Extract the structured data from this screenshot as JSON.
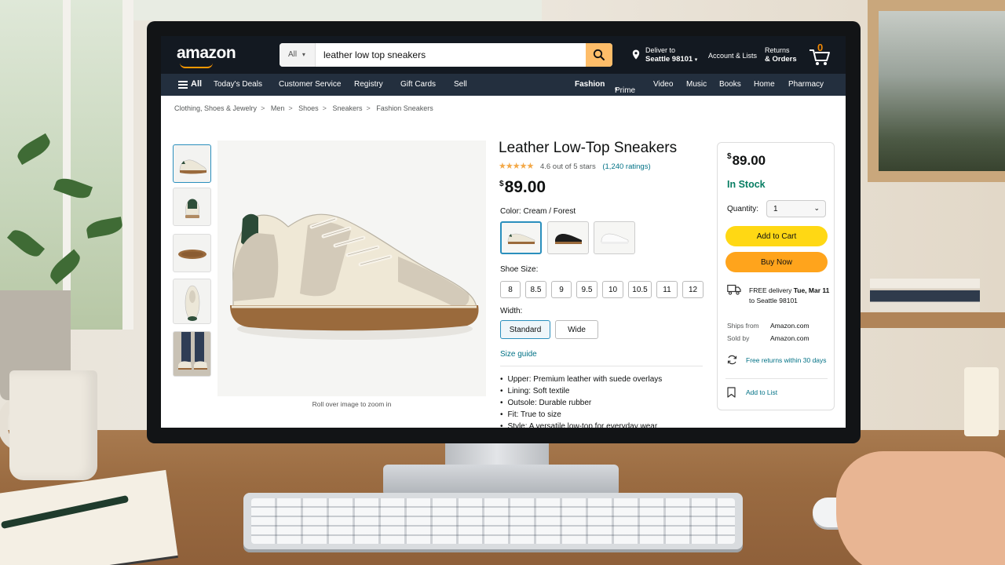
{
  "header": {
    "logo": "amazon",
    "search_category": "All",
    "search_query": "leather low top sneakers",
    "deliver_line1": "Deliver to",
    "deliver_line2": "Seattle 98101",
    "account": "Account & Lists",
    "returns_line1": "Returns",
    "returns_line2": "& Orders",
    "cart_count": "0"
  },
  "nav": {
    "all": "All",
    "left": [
      "Today's Deals",
      "Customer Service",
      "Registry",
      "Gift Cards",
      "Sell"
    ],
    "right": [
      "Fashion",
      "Prime",
      "Video",
      "Music",
      "Books",
      "Home",
      "Pharmacy"
    ]
  },
  "breadcrumb": [
    "Clothing, Shoes & Jewelry",
    "Men",
    "Shoes",
    "Sneakers",
    "Fashion Sneakers"
  ],
  "gallery": {
    "thumbnail_count": 5,
    "zoom_hint": "Roll over image to zoom in"
  },
  "product": {
    "title": "Leather Low-Top Sneakers",
    "rating_text": "4.6 out of 5 stars",
    "rating_value": 4.6,
    "ratings_link": "(1,240 ratings)",
    "price_symbol": "$",
    "price": "89.00",
    "color_label": "Color:",
    "color_value": "Cream / Forest",
    "color_options": [
      "Cream / Forest",
      "Black",
      "White"
    ],
    "size_label": "Shoe Size:",
    "sizes": [
      "8",
      "8.5",
      "9",
      "9.5",
      "10",
      "10.5",
      "11",
      "12"
    ],
    "width_label": "Width:",
    "widths": [
      "Standard",
      "Wide"
    ],
    "size_guide": "Size guide",
    "bullets": [
      "Upper: Premium leather with suede overlays",
      "Lining: Soft textile",
      "Outsole: Durable rubber",
      "Fit: True to size",
      "Style: A versatile low-top for everyday wear"
    ]
  },
  "buybox": {
    "price_symbol": "$",
    "price": "89.00",
    "stock": "In Stock",
    "qty_label": "Quantity:",
    "qty_value": "1",
    "add_to_cart": "Add to Cart",
    "buy_now": "Buy Now",
    "delivery_prefix": "FREE delivery",
    "delivery_date": "Tue, Mar 11",
    "delivery_place": "to Seattle 98101",
    "ships_from_label": "Ships from",
    "ships_from": "Amazon.com",
    "sold_by_label": "Sold by",
    "sold_by": "Amazon.com",
    "returns": "Free returns within 30 days",
    "add_to_list": "Add to List"
  },
  "colors": {
    "header_bg": "#131921",
    "subnav_bg": "#232f3e",
    "accent_orange": "#ff9900",
    "add_to_cart": "#ffd814",
    "buy_now": "#ffa41c",
    "link": "#007185",
    "in_stock": "#067d62"
  }
}
